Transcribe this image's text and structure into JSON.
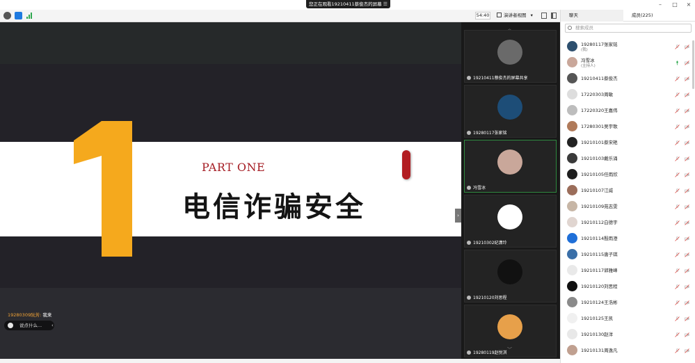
{
  "titlebar": {
    "share_banner": "您正在观看19210411蔡俊杰的屏幕",
    "banner_menu": "☰",
    "minimize": "–",
    "restore": "□",
    "close": "×"
  },
  "toolbar": {
    "timer": "54:40",
    "view_label": "演讲者视图",
    "view_caret": "▾"
  },
  "slide": {
    "part_label": "PART ONE",
    "title": "电信诈骗安全",
    "number": "1",
    "colors": {
      "accent_orange": "#f5a91d",
      "accent_red": "#a51d24"
    }
  },
  "chat": {
    "last_sender": "19280309阮芳:",
    "last_message": "我来",
    "placeholder": "说点什么...",
    "collapse": "‹"
  },
  "side_toggle": "›",
  "video_strip": {
    "up": "︿",
    "down": "﹀",
    "tiles": [
      {
        "label": "19210411蔡俊杰的屏幕共享",
        "avatar_color": "#6a6a6a",
        "active": false
      },
      {
        "label": "19280117张家铭",
        "avatar_color": "#1d4d77",
        "active": false
      },
      {
        "label": "冯雪冰",
        "avatar_color": "#c9a79a",
        "active": true
      },
      {
        "label": "19210302纪潇玲",
        "avatar_color": "#ffffff",
        "active": false
      },
      {
        "label": "19210120刘思程",
        "avatar_color": "#111111",
        "active": false
      },
      {
        "label": "19280119赵悦淇",
        "avatar_color": "#e7a04a",
        "active": false
      }
    ]
  },
  "panel": {
    "tab_chat": "聊天",
    "tab_members": "成员(225)",
    "search_placeholder": "搜索成员",
    "members": [
      {
        "name": "19280117张家铭",
        "role": "(我)",
        "avatar": "#2d4f6e"
      },
      {
        "name": "冯雪冰",
        "role": "(主持人)",
        "avatar": "#c9a79a"
      },
      {
        "name": "19210411蔡俊杰",
        "role": "",
        "avatar": "#555555"
      },
      {
        "name": "17220303周敏",
        "role": "",
        "avatar": "#dddddd"
      },
      {
        "name": "17220320王嘉伟",
        "role": "",
        "avatar": "#bdbdbd"
      },
      {
        "name": "17280301吴宇歌",
        "role": "",
        "avatar": "#b07a5a"
      },
      {
        "name": "19210101蔡宋艳",
        "role": "",
        "avatar": "#222222"
      },
      {
        "name": "19210103戴乐涌",
        "role": "",
        "avatar": "#3a3a3a"
      },
      {
        "name": "19210105任雨欣",
        "role": "",
        "avatar": "#1e1e1e"
      },
      {
        "name": "19210107江威",
        "role": "",
        "avatar": "#9b6d5a"
      },
      {
        "name": "19210109苑志雯",
        "role": "",
        "avatar": "#c7b6a6"
      },
      {
        "name": "19210112白德宇",
        "role": "",
        "avatar": "#e0d5d0"
      },
      {
        "name": "19210114殷雨澄",
        "role": "",
        "avatar": "#1f6fd8"
      },
      {
        "name": "19210115唐子琪",
        "role": "",
        "avatar": "#3a6fa8"
      },
      {
        "name": "19210117郭雅峰",
        "role": "",
        "avatar": "#e9e9e9"
      },
      {
        "name": "19210120刘思程",
        "role": "",
        "avatar": "#101010"
      },
      {
        "name": "19210124王浩彬",
        "role": "",
        "avatar": "#8a8a8a"
      },
      {
        "name": "19210125王凯",
        "role": "",
        "avatar": "#f0f0f0"
      },
      {
        "name": "19210130赵洋",
        "role": "",
        "avatar": "#e8e8e8"
      },
      {
        "name": "19210131周逸凡",
        "role": "",
        "avatar": "#c0a090"
      }
    ]
  }
}
